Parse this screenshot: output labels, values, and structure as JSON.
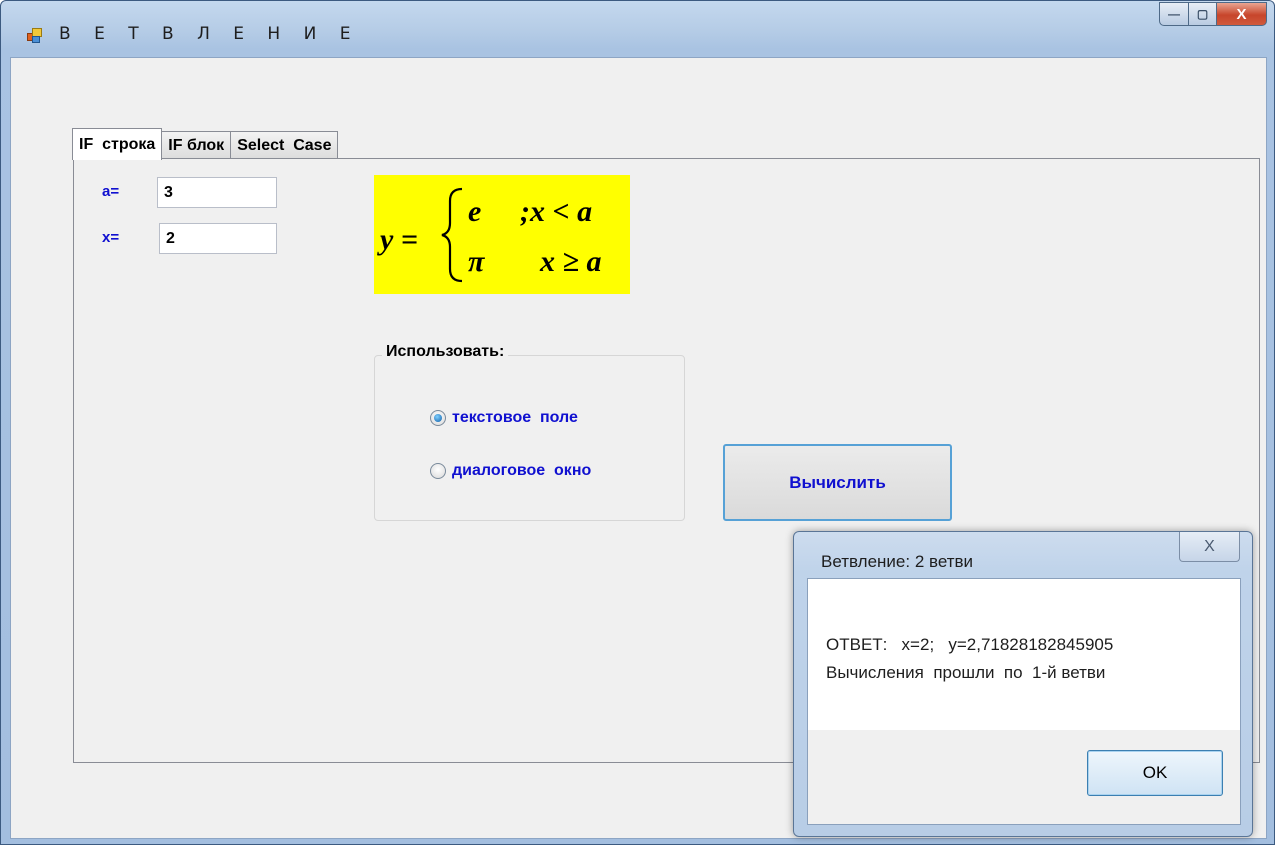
{
  "window": {
    "title": "В Е Т В Л Е Н И Е",
    "minimize_glyph": "—",
    "maximize_glyph": "▢",
    "close_glyph": "X"
  },
  "tabs": [
    {
      "label": "IF  строка",
      "active": true
    },
    {
      "label": "IF блок",
      "active": false
    },
    {
      "label": "Select  Case",
      "active": false
    }
  ],
  "fields": {
    "a_label": "a=",
    "a_value": "3",
    "x_label": "x=",
    "x_value": "2"
  },
  "formula": {
    "lhs": "y =",
    "branch1_value": "e",
    "branch1_condition": ";x < a",
    "branch2_value": "π",
    "branch2_condition": "x ≥ a",
    "background_color": "#ffff00"
  },
  "group": {
    "title": "Использовать:",
    "options": [
      {
        "label": "текстовое  поле",
        "checked": true
      },
      {
        "label": "диалоговое  окно",
        "checked": false
      }
    ]
  },
  "calc_button_label": "Вычислить",
  "messagebox": {
    "title": "Ветвление: 2 ветви",
    "close_glyph": "X",
    "line1": "ОТВЕТ:   x=2;   y=2,71828182845905",
    "line2": "Вычисления  прошли  по  1-й ветви",
    "ok_label": "OK"
  },
  "colors": {
    "label_blue": "#1010d0",
    "formula_bg": "#ffff00",
    "window_frame": "#a9c3e2"
  }
}
